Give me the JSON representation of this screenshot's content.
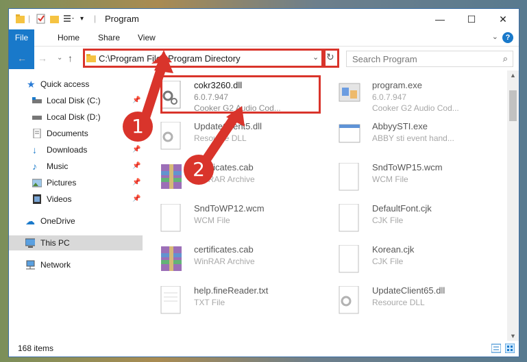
{
  "window": {
    "title": "Program"
  },
  "ribbon": {
    "tabs": [
      "File",
      "Home",
      "Share",
      "View"
    ],
    "help": "?"
  },
  "address": {
    "path": "C:\\Program Files\\Program Directory",
    "search_placeholder": "Search Program"
  },
  "nav": {
    "items": [
      {
        "label": "Quick access",
        "icon": "star-icon"
      },
      {
        "label": "Local Disk (C:)",
        "icon": "drive-icon"
      },
      {
        "label": "Local Disk (D:)",
        "icon": "drive-icon"
      },
      {
        "label": "Documents",
        "icon": "documents-icon"
      },
      {
        "label": "Downloads",
        "icon": "download-icon"
      },
      {
        "label": "Music",
        "icon": "music-icon"
      },
      {
        "label": "Pictures",
        "icon": "pictures-icon"
      },
      {
        "label": "Videos",
        "icon": "videos-icon"
      },
      {
        "label": "OneDrive",
        "icon": "cloud-icon"
      },
      {
        "label": "This PC",
        "icon": "computer-icon"
      },
      {
        "label": "Network",
        "icon": "network-icon"
      }
    ]
  },
  "files": [
    {
      "name": "cokr3260.dll",
      "line2": "6.0.7.947",
      "line3": "Cooker G2 Audio Cod...",
      "icon": "dll-icon"
    },
    {
      "name": "program.exe",
      "line2": "6.0.7.947",
      "line3": "Cooker G2 Audio Cod...",
      "icon": "exe-icon"
    },
    {
      "name": "UpdateClient5.dll",
      "line2": "Resource DLL",
      "line3": "",
      "icon": "dll-icon"
    },
    {
      "name": "AbbyySTI.exe",
      "line2": "ABBY sti event hand...",
      "line3": "",
      "icon": "exe-icon"
    },
    {
      "name": "certificates.cab",
      "line2": "WinRAR Archive",
      "line3": "",
      "icon": "archive-icon"
    },
    {
      "name": "SndToWP15.wcm",
      "line2": "WCM File",
      "line3": "",
      "icon": "file-icon"
    },
    {
      "name": "SndToWP12.wcm",
      "line2": "WCM File",
      "line3": "",
      "icon": "file-icon"
    },
    {
      "name": "DefaultFont.cjk",
      "line2": "CJK File",
      "line3": "",
      "icon": "file-icon"
    },
    {
      "name": "certificates.cab",
      "line2": "WinRAR Archive",
      "line3": "",
      "icon": "archive-icon"
    },
    {
      "name": "Korean.cjk",
      "line2": "CJK File",
      "line3": "",
      "icon": "file-icon"
    },
    {
      "name": "help.fineReader.txt",
      "line2": "TXT File",
      "line3": "",
      "icon": "text-file-icon"
    },
    {
      "name": "UpdateClient65.dll",
      "line2": "Resource DLL",
      "line3": "",
      "icon": "dll-icon"
    }
  ],
  "status": {
    "count": "168 items"
  },
  "callouts": [
    "1",
    "2"
  ],
  "colors": {
    "accent": "#1979ca",
    "highlight": "#d9342b"
  }
}
